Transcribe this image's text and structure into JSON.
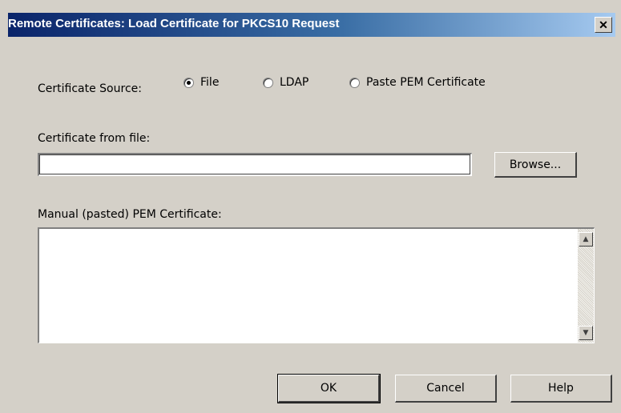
{
  "window": {
    "title": "Remote Certificates: Load Certificate for PKCS10 Request",
    "close_glyph": "✕"
  },
  "source": {
    "label": "Certificate Source:",
    "options": [
      {
        "label": "File",
        "checked": true
      },
      {
        "label": "LDAP",
        "checked": false
      },
      {
        "label": "Paste PEM Certificate",
        "checked": false
      }
    ]
  },
  "file": {
    "label": "Certificate from file:",
    "value": "",
    "browse_label": "Browse..."
  },
  "manual": {
    "label": "Manual (pasted) PEM Certificate:",
    "value": ""
  },
  "buttons": {
    "ok": "OK",
    "cancel": "Cancel",
    "help": "Help"
  },
  "icons": {
    "scroll_up": "▲",
    "scroll_down": "▼"
  }
}
